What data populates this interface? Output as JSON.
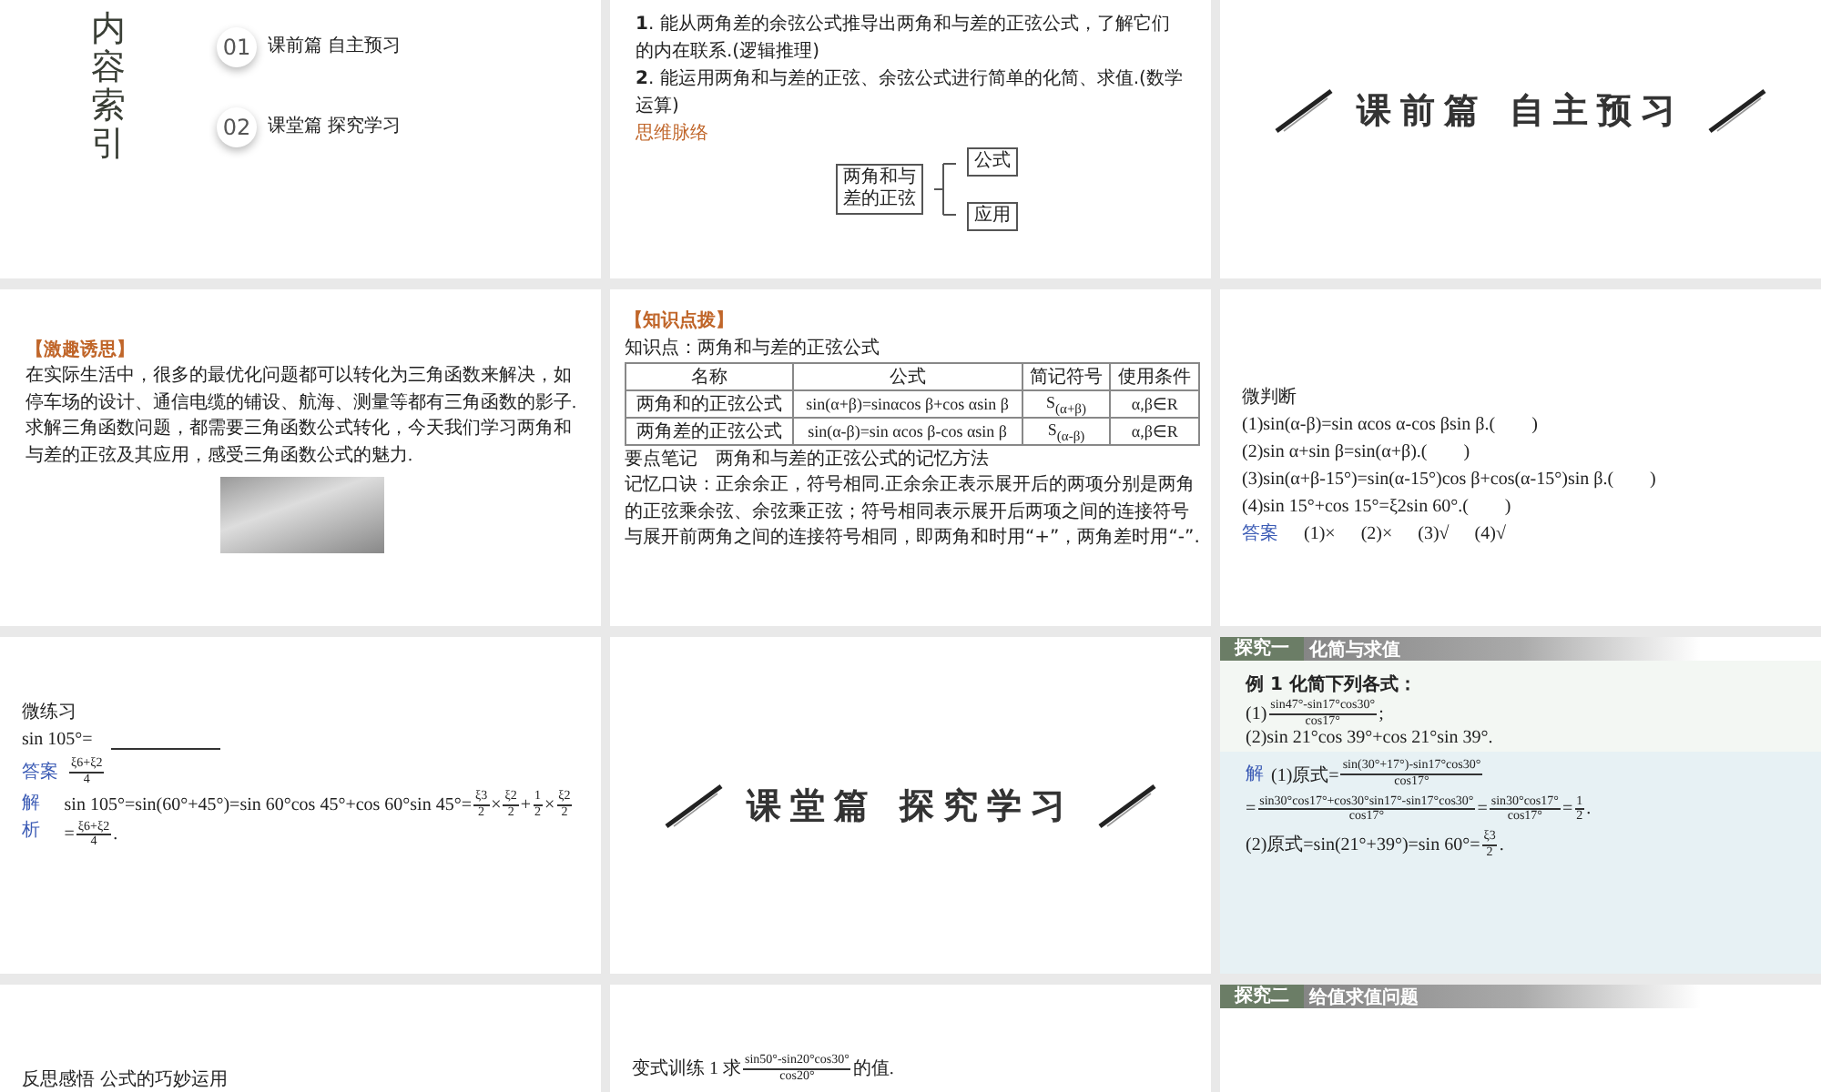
{
  "slides": [
    {
      "kind": "index",
      "title": "内容索引",
      "items": [
        {
          "num": "01",
          "label": "课前篇 自主预习"
        },
        {
          "num": "02",
          "label": "课堂篇 探究学习"
        }
      ]
    },
    {
      "kind": "goals",
      "lines": [
        "**1**. 能从两角差的余弦公式推导出两角和与差的正弦公式，了解它们的内在联系.(逻辑推理)",
        "**2**. 能运用两角和与差的正弦、余弦公式进行简单的化简、求值.(数学运算)"
      ],
      "map_title": "思维脉络",
      "map_root": "两角和与差的正弦",
      "map_branches": [
        "公式",
        "应用"
      ]
    },
    {
      "kind": "section",
      "title": "课前篇 自主预习"
    },
    {
      "kind": "intro",
      "tag": "【激趣诱思】",
      "text": "在实际生活中，很多的最优化问题都可以转化为三角函数来解决，如停车场的设计、通信电缆的铺设、航海、测量等都有三角函数的影子.求解三角函数问题，都需要三角函数公式转化，今天我们学习两角和与差的正弦及其应用，感受三角函数公式的魅力."
    },
    {
      "kind": "knowledge",
      "tag": "【知识点拨】",
      "heading": "知识点：两角和与差的正弦公式",
      "columns": [
        "名称",
        "公式",
        "简记符号",
        "使用条件"
      ],
      "rows": [
        [
          "两角和的正弦公式",
          "sin(α+β)=sinαcos β+cos αsin β",
          "S$_{(α+β)}$",
          "α,β∈R"
        ],
        [
          "两角差的正弦公式",
          "sin(α-β)=sin αcos β-cos αsin β",
          "S$_{(α-β)}$",
          "α,β∈R"
        ]
      ],
      "note_title": "要点笔记　两角和与差的正弦公式的记忆方法",
      "note": "记忆口诀：正余余正，符号相同.正余余正表示展开后的两项分别是两角的正弦乘余弦、余弦乘正弦；符号相同表示展开后两项之间的连接符号与展开前两角之间的连接符号相同，即两角和时用“+”，两角差时用“-”."
    },
    {
      "kind": "quiz",
      "title": "微判断",
      "items": [
        "(1)sin(α-β)=sin αcos α-cos βsin β.(　　)",
        "(2)sin α+sin β=sin(α+β).(　　)",
        "(3)sin(α+β-15°)=sin(α-15°)cos β+cos(α-15°)sin β.(　　)",
        "(4)sin 15°+cos 15°=ξ2sin 60°.(　　)"
      ],
      "answer_label": "答案",
      "answers": [
        "(1)×",
        "(2)×",
        "(3)√",
        "(4)√"
      ]
    },
    {
      "kind": "practice",
      "title": "微练习",
      "question": "sin 105°=",
      "answer_label": "答案",
      "answer": [
        {
          "num": "ξ6+ξ2",
          "den": "4"
        }
      ],
      "analysis_label": "解析",
      "analysis": [
        "sin 105°=sin(60°+45°)=sin 60°cos 45°+cos 60°sin 45°=",
        {
          "num": "ξ3",
          "den": "2"
        },
        "×",
        {
          "num": "ξ2",
          "den": "2"
        },
        "+",
        {
          "num": "1",
          "den": "2"
        },
        "×",
        {
          "num": "ξ2",
          "den": "2"
        },
        "=",
        {
          "num": "ξ6+ξ2",
          "den": "4"
        },
        "."
      ]
    },
    {
      "kind": "section",
      "title": "课堂篇 探究学习"
    },
    {
      "kind": "example",
      "tag": "探究一",
      "title": "化简与求值",
      "prompt": "例 1 化简下列各式：",
      "parts": [
        [
          "(1)",
          {
            "num": "sin47°-sin17°cos30°",
            "den": "cos17°"
          },
          ";"
        ],
        [
          "(2)sin 21°cos 39°+cos 21°sin 39°."
        ]
      ],
      "solution_label": "解",
      "solution": [
        [
          "(1)原式=",
          {
            "num": "sin(30°+17°)-sin17°cos30°",
            "den": "cos17°"
          }
        ],
        [
          "=",
          {
            "num": "sin30°cos17°+cos30°sin17°-sin17°cos30°",
            "den": "cos17°"
          },
          "=",
          {
            "num": "sin30°cos17°",
            "den": "cos17°"
          },
          "=",
          {
            "num": "1",
            "den": "2"
          },
          "."
        ],
        [
          "(2)原式=sin(21°+39°)=sin 60°=",
          {
            "num": "ξ3",
            "den": "2"
          },
          "."
        ]
      ]
    },
    {
      "kind": "reflect",
      "title": "反思感悟 公式的巧妙运用"
    },
    {
      "kind": "variant",
      "text": [
        "变式训练 1 求",
        {
          "num": "sin50°-sin20°cos30°",
          "den": "cos20°"
        },
        "的值."
      ]
    },
    {
      "kind": "header",
      "tag": "探究二",
      "title": "给值求值问题"
    }
  ]
}
